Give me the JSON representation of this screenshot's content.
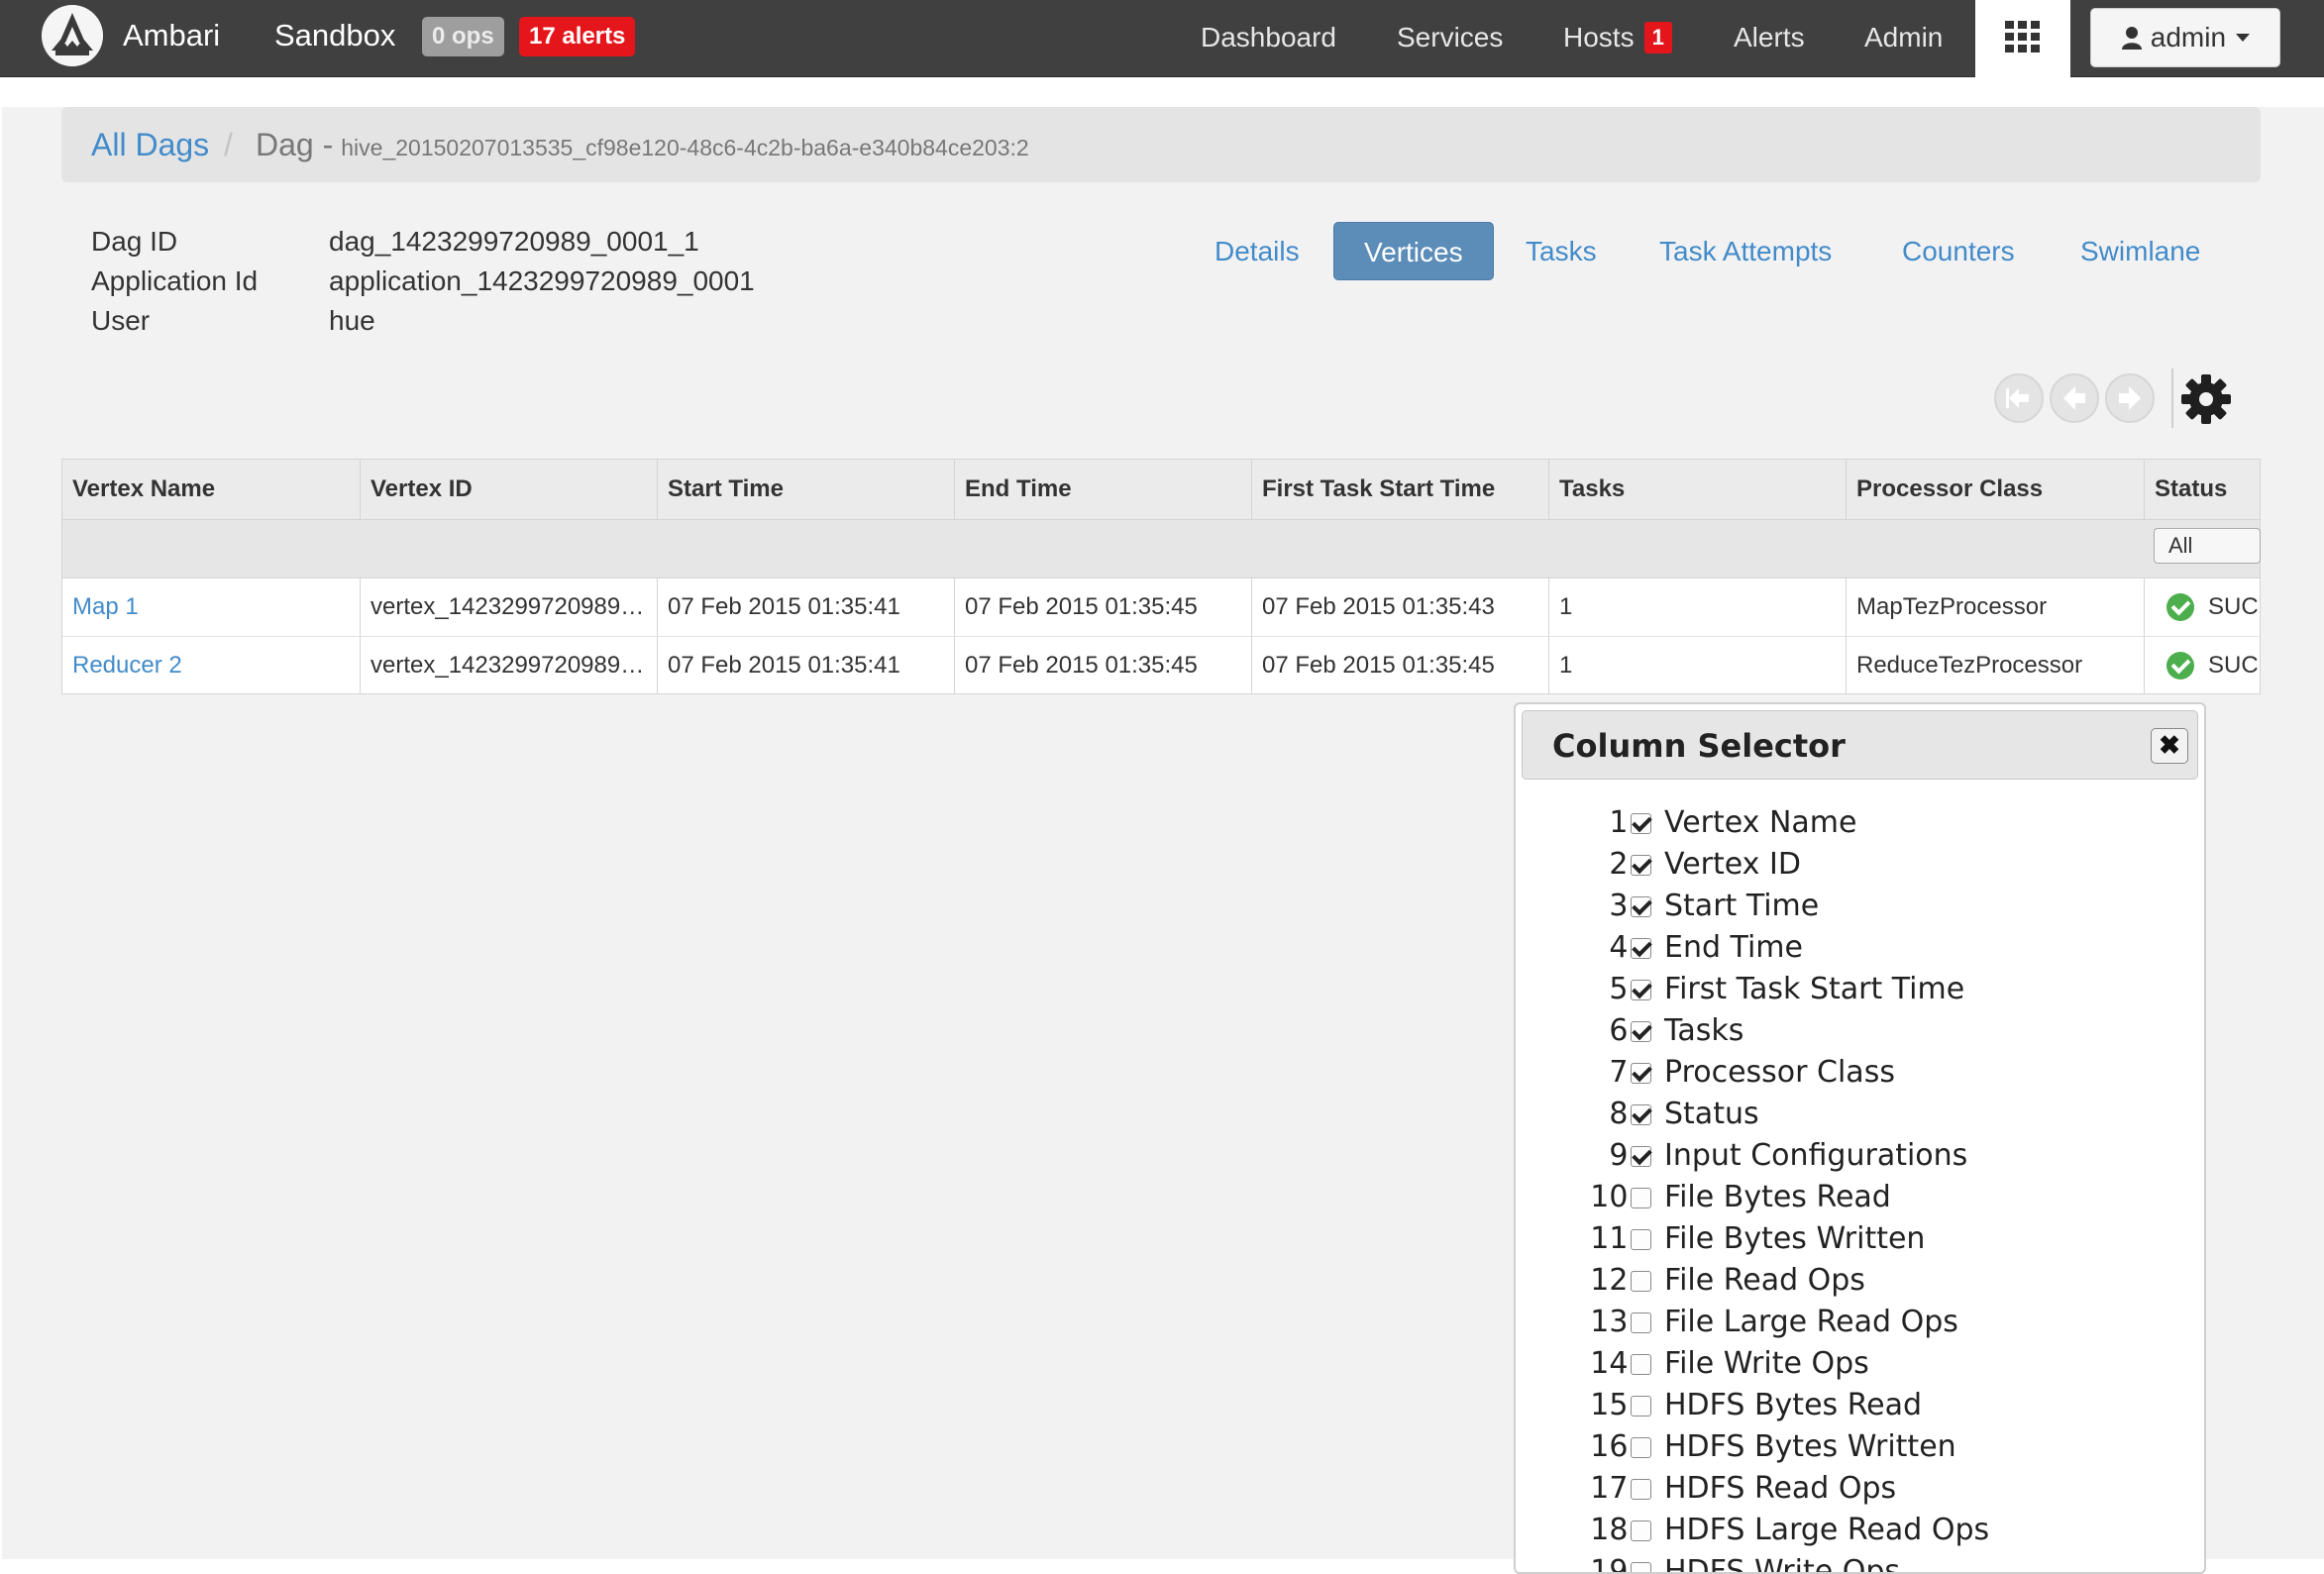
{
  "topbar": {
    "brand": "Ambari",
    "cluster": "Sandbox",
    "ops_badge": "0 ops",
    "alerts_badge": "17 alerts",
    "nav": [
      "Dashboard",
      "Services",
      "Hosts",
      "Alerts",
      "Admin"
    ],
    "hosts_badge": "1",
    "user": "admin"
  },
  "breadcrumb": {
    "root": "All Dags",
    "separator": "/",
    "current_prefix": "Dag -",
    "current_id": "hive_20150207013535_cf98e120-48c6-4c2b-ba6a-e340b84ce203:2"
  },
  "info": [
    {
      "label": "Dag ID",
      "value": "dag_1423299720989_0001_1"
    },
    {
      "label": "Application Id",
      "value": "application_1423299720989_0001"
    },
    {
      "label": "User",
      "value": "hue"
    }
  ],
  "tabs": [
    "Details",
    "Vertices",
    "Tasks",
    "Task Attempts",
    "Counters",
    "Swimlane"
  ],
  "active_tab": "Vertices",
  "table": {
    "columns": [
      "Vertex Name",
      "Vertex ID",
      "Start Time",
      "End Time",
      "First Task Start Time",
      "Tasks",
      "Processor Class",
      "Status"
    ],
    "status_filter": "All",
    "rows": [
      {
        "name": "Map 1",
        "id": "vertex_1423299720989…",
        "start": "07 Feb 2015 01:35:41",
        "end": "07 Feb 2015 01:35:45",
        "first_task": "07 Feb 2015 01:35:43",
        "tasks": "1",
        "processor": "MapTezProcessor",
        "status": "SUC"
      },
      {
        "name": "Reducer 2",
        "id": "vertex_1423299720989…",
        "start": "07 Feb 2015 01:35:41",
        "end": "07 Feb 2015 01:35:45",
        "first_task": "07 Feb 2015 01:35:45",
        "tasks": "1",
        "processor": "ReduceTezProcessor",
        "status": "SUC"
      }
    ]
  },
  "column_selector": {
    "title": "Column Selector",
    "close_glyph": "✖",
    "items": [
      {
        "num": "1.",
        "label": "Vertex Name",
        "checked": true
      },
      {
        "num": "2.",
        "label": "Vertex ID",
        "checked": true
      },
      {
        "num": "3.",
        "label": "Start Time",
        "checked": true
      },
      {
        "num": "4.",
        "label": "End Time",
        "checked": true
      },
      {
        "num": "5.",
        "label": "First Task Start Time",
        "checked": true
      },
      {
        "num": "6.",
        "label": "Tasks",
        "checked": true
      },
      {
        "num": "7.",
        "label": "Processor Class",
        "checked": true
      },
      {
        "num": "8.",
        "label": "Status",
        "checked": true
      },
      {
        "num": "9.",
        "label": "Input Configurations",
        "checked": true
      },
      {
        "num": "10.",
        "label": "File Bytes Read",
        "checked": false
      },
      {
        "num": "11.",
        "label": "File Bytes Written",
        "checked": false
      },
      {
        "num": "12.",
        "label": "File Read Ops",
        "checked": false
      },
      {
        "num": "13.",
        "label": "File Large Read Ops",
        "checked": false
      },
      {
        "num": "14.",
        "label": "File Write Ops",
        "checked": false
      },
      {
        "num": "15.",
        "label": "HDFS Bytes Read",
        "checked": false
      },
      {
        "num": "16.",
        "label": "HDFS Bytes Written",
        "checked": false
      },
      {
        "num": "17.",
        "label": "HDFS Read Ops",
        "checked": false
      },
      {
        "num": "18.",
        "label": "HDFS Large Read Ops",
        "checked": false
      },
      {
        "num": "19.",
        "label": "HDFS Write Ops",
        "checked": false
      }
    ]
  },
  "icons": {
    "logo": "ambari-logo-icon",
    "apps": "grid-icon",
    "user": "user-icon",
    "pager_first": "arrow-first-icon",
    "pager_prev": "arrow-left-icon",
    "pager_next": "arrow-right-icon",
    "settings": "gear-icon",
    "status": "check-circle-icon"
  },
  "colors": {
    "navbar": "#404040",
    "link": "#428bca",
    "active_tab": "#5b8db8",
    "alert": "#e4161b",
    "success": "#4cae4c"
  }
}
